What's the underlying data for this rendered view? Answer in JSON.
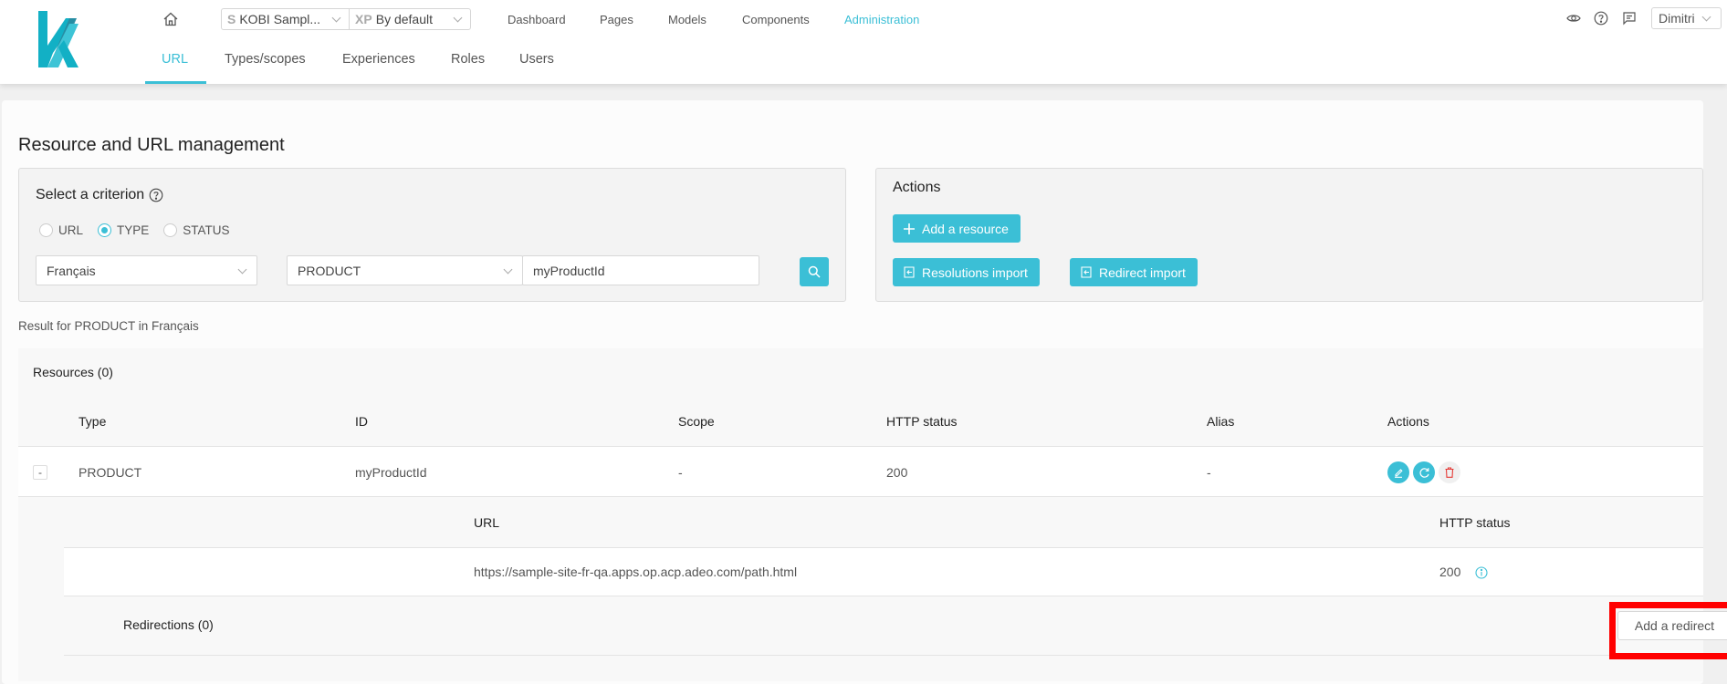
{
  "header": {
    "site_selector": {
      "prefix": "S",
      "value": "KOBI Sampl..."
    },
    "experience_selector": {
      "prefix": "XP",
      "value": "By default"
    },
    "nav": [
      {
        "label": "Dashboard",
        "active": false
      },
      {
        "label": "Pages",
        "active": false
      },
      {
        "label": "Models",
        "active": false
      },
      {
        "label": "Components",
        "active": false
      },
      {
        "label": "Administration",
        "active": true
      }
    ],
    "icons": [
      "eye-icon",
      "help-icon",
      "chat-icon"
    ],
    "user": "Dimitri"
  },
  "subtabs": [
    {
      "label": "URL",
      "active": true
    },
    {
      "label": "Types/scopes",
      "active": false
    },
    {
      "label": "Experiences",
      "active": false
    },
    {
      "label": "Roles",
      "active": false
    },
    {
      "label": "Users",
      "active": false
    }
  ],
  "page": {
    "title": "Resource and URL management",
    "criterion": {
      "title": "Select a criterion",
      "radios": [
        {
          "label": "URL",
          "checked": false
        },
        {
          "label": "TYPE",
          "checked": true
        },
        {
          "label": "STATUS",
          "checked": false
        }
      ],
      "language": "Français",
      "type": "PRODUCT",
      "id_value": "myProductId"
    },
    "actions": {
      "title": "Actions",
      "add_resource": "Add a resource",
      "resolutions_import": "Resolutions import",
      "redirect_import": "Redirect import"
    },
    "result_text": "Result for PRODUCT in Français",
    "resources": {
      "title": "Resources (0)",
      "columns": [
        "Type",
        "ID",
        "Scope",
        "HTTP status",
        "Alias",
        "Actions"
      ],
      "rows": [
        {
          "expand": "-",
          "type": "PRODUCT",
          "id": "myProductId",
          "scope": "-",
          "http_status": "200",
          "alias": "-"
        }
      ],
      "nested": {
        "columns": [
          "URL",
          "HTTP status"
        ],
        "rows": [
          {
            "url": "https://sample-site-fr-qa.apps.op.acp.adeo.com/path.html",
            "http_status": "200"
          }
        ],
        "redirections_title": "Redirections (0)",
        "add_redirect": "Add a redirect"
      }
    }
  },
  "colors": {
    "accent": "#3bbfd6",
    "danger": "#e53935",
    "highlight": "#ff0000"
  }
}
